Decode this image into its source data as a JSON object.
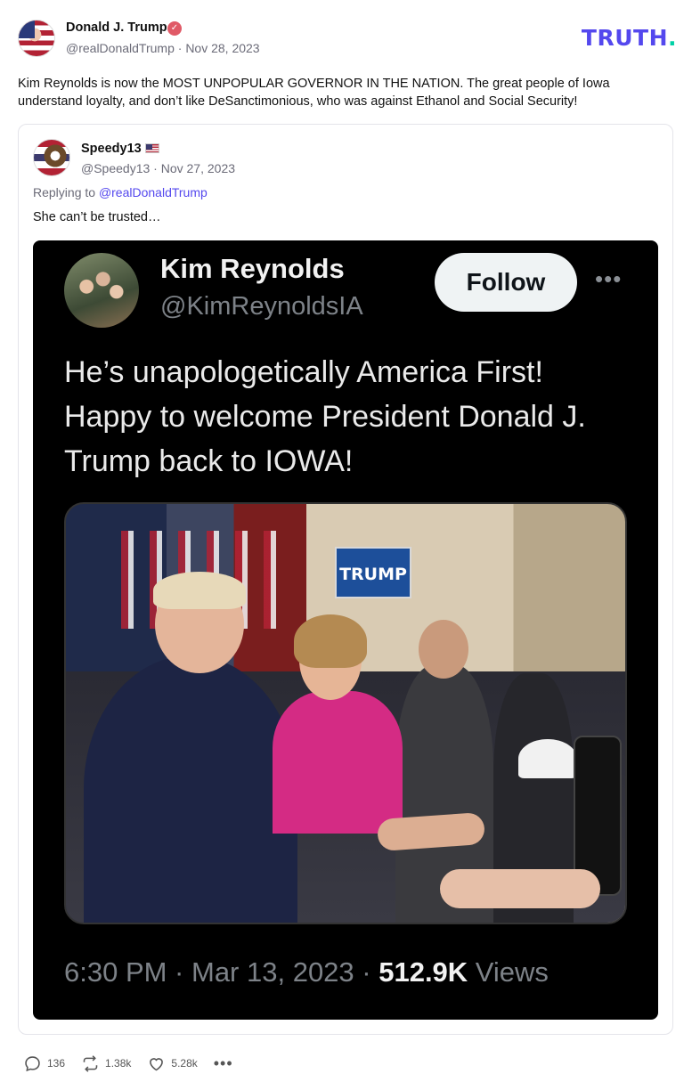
{
  "post": {
    "author_name": "Donald J. Trump",
    "author_handle": "@realDonaldTrump",
    "date": "Nov 28, 2023",
    "brand": "TRUTH",
    "brand_dot": ".",
    "text": "Kim Reynolds is now the MOST UNPOPULAR GOVERNOR IN THE NATION. The great people of Iowa understand loyalty, and don’t like DeSanctimonious, who was against Ethanol and Social Security!",
    "verified_icon": "verified-check-icon",
    "colors": {
      "brand": "#5448ee",
      "brand_dot": "#00d1a6",
      "verified": "#e05a67"
    }
  },
  "quote": {
    "author_name": "Speedy13",
    "author_handle": "@Speedy13",
    "date": "Nov 27, 2023",
    "replying_prefix": "Replying to",
    "replying_to": "@realDonaldTrump",
    "text": "She can’t be trusted…",
    "embed": {
      "name": "Kim Reynolds",
      "handle": "@KimReynoldsIA",
      "follow_label": "Follow",
      "more_label": "•••",
      "text": "He’s unapologetically America First! Happy to welcome President Donald J. Trump back to IOWA!",
      "photo_sign": "TRUMP",
      "time_date": "6:30 PM · Mar 13, 2023 · ",
      "views_count": "512.9K",
      "views_label": " Views"
    }
  },
  "actions": {
    "replies": "136",
    "reposts": "1.38k",
    "likes": "5.28k",
    "more_label": "•••",
    "icons": [
      "reply-icon",
      "repost-icon",
      "like-icon",
      "more-icon"
    ]
  }
}
